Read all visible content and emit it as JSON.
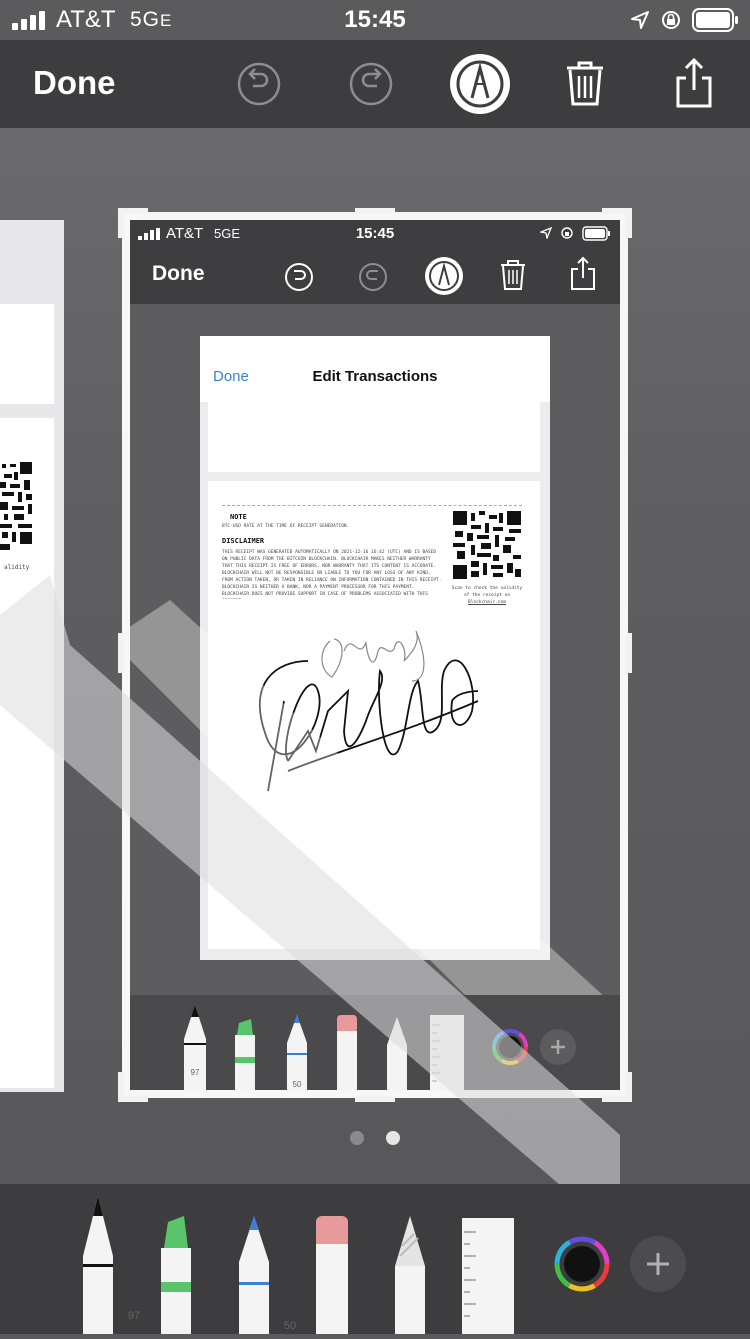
{
  "status_bar": {
    "carrier": "AT&T",
    "network": "5G",
    "network_suffix": "E",
    "time": "15:45"
  },
  "toolbar": {
    "done_label": "Done"
  },
  "thumbnail": {
    "status": {
      "carrier": "AT&T",
      "network": "5G",
      "network_suffix": "E",
      "time": "15:45"
    },
    "done_label": "Done",
    "document": {
      "done_label": "Done",
      "title": "Edit Transactions",
      "note_heading": "NOTE",
      "note_text": "BTC-USD RATE AT THE TIME OF RECEIPT GENERATION.",
      "disclaimer_heading": "DISCLAIMER",
      "disclaimer_text": "THIS RECEIPT WAS GENERATED AUTOMATICALLY ON 2021-12-16 16:42 (UTC) AND IS BASED ON PUBLIC DATA FROM THE BITCOIN BLOCKCHAIN. BLOCKCHAIR MAKES NEITHER WARRANTY THAT THIS RECEIPT IS FREE OF ERRORS, NOR WARRANTY THAT ITS CONTENT IS ACCURATE. BLOCKCHAIR WILL NOT BE RESPONSIBLE OR LIABLE TO YOU FOR ANY LOSS OF ANY KIND, FROM ACTION TAKEN, OR TAKEN IN RELIANCE ON INFORMATION CONTAINED IN THIS RECEIPT. BLOCKCHAIR IS NEITHER A BANK, NOR A PAYMENT PROCESSOR FOR THIS PAYMENT. BLOCKCHAIR DOES NOT PROVIDE SUPPORT IN CASE OF PROBLEMS ASSOCIATED WITH THIS RECEIPT.",
      "qr_caption_1": "Scan to check the validity",
      "qr_caption_2": "of the receipt on",
      "qr_caption_3": "Blockchair.com"
    },
    "tools": {
      "pen_width": "97",
      "pencil_width": "50"
    }
  },
  "left_page": {
    "caption": "alidity"
  },
  "page_indicator": {
    "count": 2,
    "current": 2
  },
  "bottom_tools": {
    "pen_width": "97",
    "pencil_width": "50"
  },
  "colors": {
    "background": "#5b5b5d",
    "toolbar": "#3d3d3f",
    "link_blue": "#3a82d6",
    "marker_green": "#59c46a",
    "pencil_blue": "#3d7fd6",
    "eraser_pink": "#e89a9a"
  },
  "icons": [
    "undo-icon",
    "redo-icon",
    "markup-icon",
    "trash-icon",
    "share-icon",
    "location-icon",
    "rotation-lock-icon",
    "battery-icon",
    "signal-icon",
    "color-wheel-icon",
    "plus-icon"
  ]
}
